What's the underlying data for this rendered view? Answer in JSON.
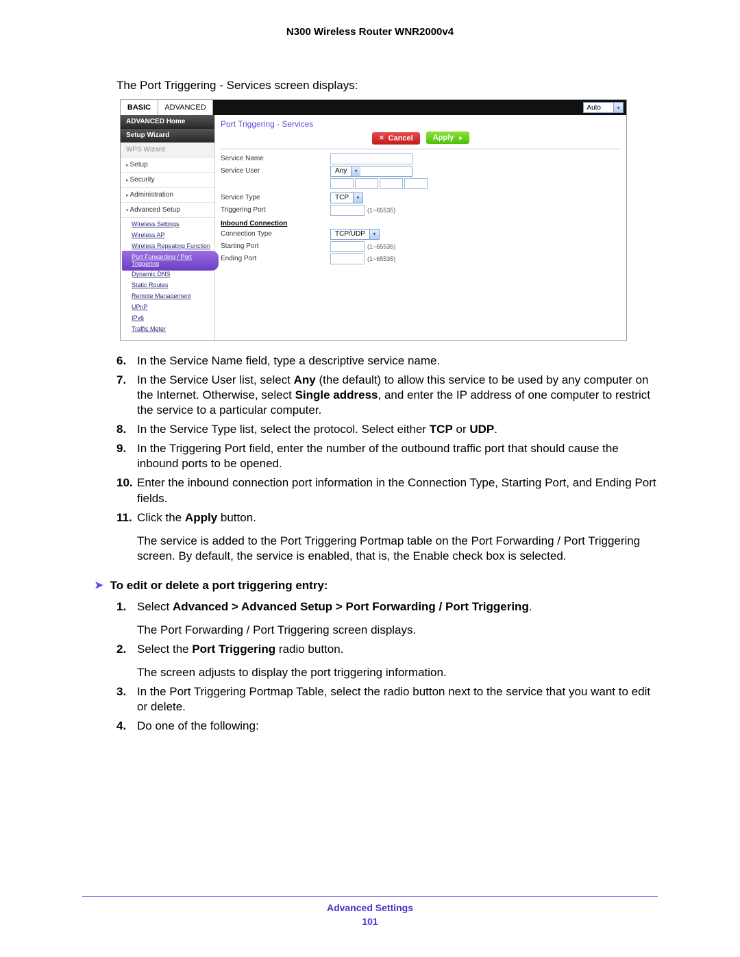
{
  "doc_title": "N300 Wireless Router WNR2000v4",
  "intro": "The Port Triggering - Services screen displays:",
  "router": {
    "tabs": {
      "basic": "BASIC",
      "advanced": "ADVANCED"
    },
    "auto": "Auto",
    "sidebar": {
      "adv_home": "ADVANCED Home",
      "setup_wizard": "Setup Wizard",
      "wps_wizard": "WPS Wizard",
      "setup": "Setup",
      "security": "Security",
      "administration": "Administration",
      "advanced_setup": "Advanced Setup",
      "subs": {
        "wireless_settings": "Wireless Settings",
        "wireless_ap": "Wireless AP",
        "wireless_repeating": "Wireless Repeating Function",
        "port_fwd": "Port Forwarding / Port Triggering",
        "dynamic_dns": "Dynamic DNS",
        "static_routes": "Static Routes",
        "remote_mgmt": "Remote Management",
        "upnp": "UPnP",
        "ipv6": "IPv6",
        "traffic_meter": "Traffic Meter"
      }
    },
    "panel": {
      "title": "Port Triggering - Services",
      "cancel": "Cancel",
      "apply": "Apply",
      "labels": {
        "service_name": "Service Name",
        "service_user": "Service User",
        "service_type": "Service Type",
        "triggering_port": "Triggering Port",
        "inbound_head": "Inbound Connection",
        "connection_type": "Connection Type",
        "starting_port": "Starting Port",
        "ending_port": "Ending Port"
      },
      "values": {
        "service_user": "Any",
        "service_type": "TCP",
        "connection_type": "TCP/UDP",
        "port_hint": "(1~65535)"
      }
    }
  },
  "steps_a": {
    "n6": "6.",
    "t6": "In the Service Name field, type a descriptive service name.",
    "n7": "7.",
    "t7a": "In the Service User list, select ",
    "t7b": "Any",
    "t7c": " (the default) to allow this service to be used by any computer on the Internet. Otherwise, select ",
    "t7d": "Single address",
    "t7e": ", and enter the IP address of one computer to restrict the service to a particular computer.",
    "n8": "8.",
    "t8a": "In the Service Type list, select the protocol. Select either ",
    "t8b": "TCP",
    "t8c": " or ",
    "t8d": "UDP",
    "t8e": ".",
    "n9": "9.",
    "t9": "In the Triggering Port field, enter the number of the outbound traffic port that should cause the inbound ports to be opened.",
    "n10": "10.",
    "t10": "Enter the inbound connection port information in the Connection Type, Starting Port, and Ending Port fields.",
    "n11": "11.",
    "t11a": "Click the ",
    "t11b": "Apply",
    "t11c": " button.",
    "t11sub": "The service is added to the Port Triggering Portmap table on the Port Forwarding / Port Triggering screen. By default, the service is enabled, that is, the Enable check box is selected."
  },
  "heading2": "To edit or delete a port triggering entry:",
  "steps_b": {
    "n1": "1.",
    "t1a": "Select ",
    "t1b": "Advanced > Advanced Setup > Port Forwarding / Port Triggering",
    "t1c": ".",
    "t1sub": "The Port Forwarding / Port Triggering screen displays.",
    "n2": "2.",
    "t2a": "Select the ",
    "t2b": "Port Triggering",
    "t2c": " radio button.",
    "t2sub": "The screen adjusts to display the port triggering information.",
    "n3": "3.",
    "t3": "In the Port Triggering Portmap Table, select the radio button next to the service that you want to edit or delete.",
    "n4": "4.",
    "t4": "Do one of the following:"
  },
  "footer": {
    "section": "Advanced Settings",
    "page": "101"
  }
}
